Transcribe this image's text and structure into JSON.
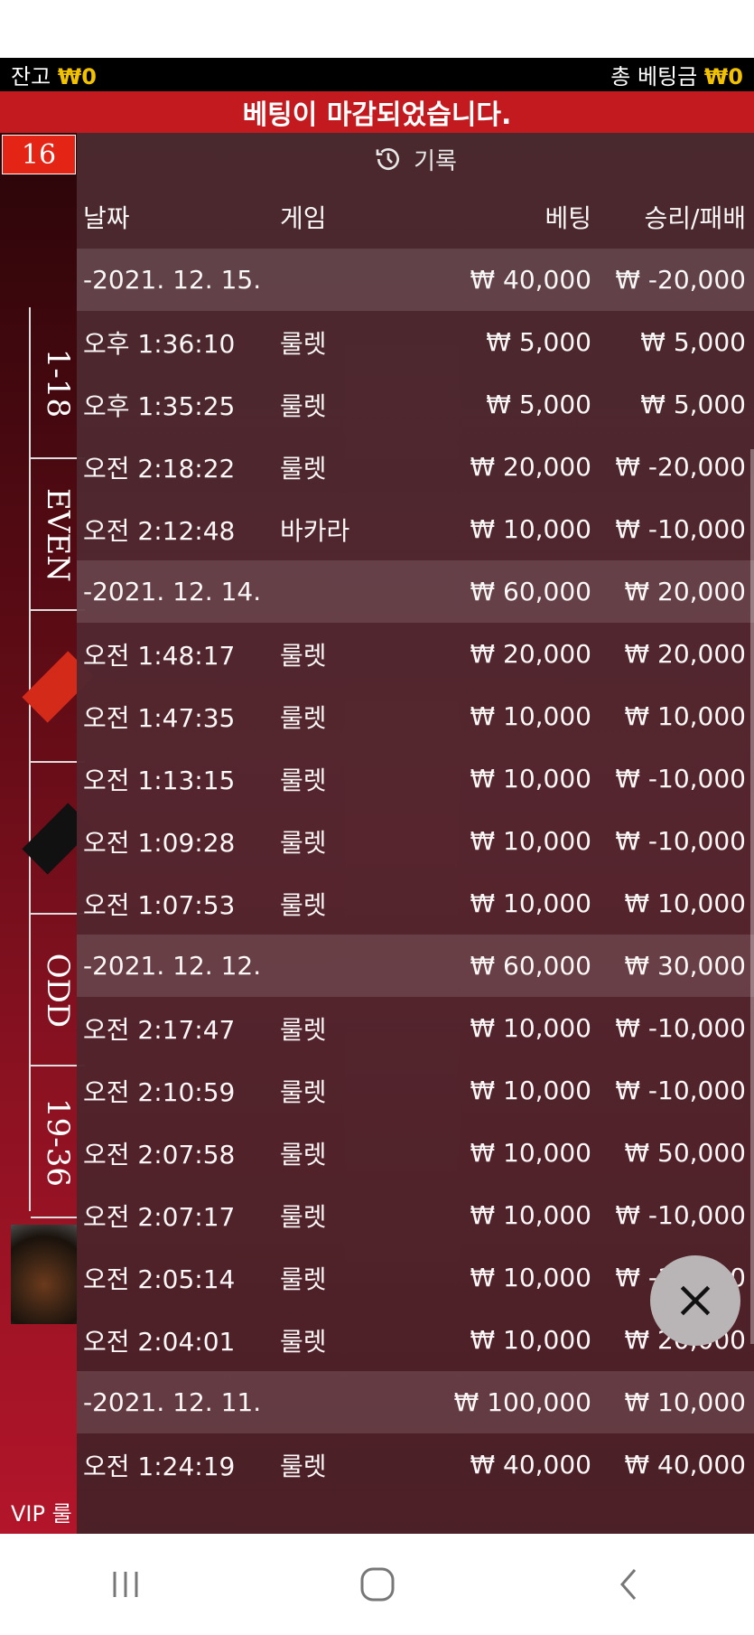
{
  "topbar": {
    "balance_label": "잔고",
    "balance_value": "₩0",
    "total_bet_label": "총 베팅금",
    "total_bet_value": "₩0"
  },
  "banner_text": "베팅이 마감되었습니다.",
  "game_number": "16",
  "board_labels": [
    "1-18",
    "EVEN",
    "",
    "",
    "ODD",
    "19-36"
  ],
  "vip_label": "VIP 룰",
  "history": {
    "title": "기록",
    "columns": {
      "date": "날짜",
      "game": "게임",
      "bet": "베팅",
      "result": "승리/패배"
    },
    "groups": [
      {
        "date": "-2021. 12. 15.",
        "bet": "₩ 40,000",
        "result": "₩ -20,000",
        "rows": [
          {
            "time": "오후 1:36:10",
            "game": "룰렛",
            "bet": "₩ 5,000",
            "result": "₩ 5,000"
          },
          {
            "time": "오후 1:35:25",
            "game": "룰렛",
            "bet": "₩ 5,000",
            "result": "₩ 5,000"
          },
          {
            "time": "오전 2:18:22",
            "game": "룰렛",
            "bet": "₩ 20,000",
            "result": "₩ -20,000"
          },
          {
            "time": "오전 2:12:48",
            "game": "바카라",
            "bet": "₩ 10,000",
            "result": "₩ -10,000"
          }
        ]
      },
      {
        "date": "-2021. 12. 14.",
        "bet": "₩ 60,000",
        "result": "₩ 20,000",
        "rows": [
          {
            "time": "오전 1:48:17",
            "game": "룰렛",
            "bet": "₩ 20,000",
            "result": "₩ 20,000"
          },
          {
            "time": "오전 1:47:35",
            "game": "룰렛",
            "bet": "₩ 10,000",
            "result": "₩ 10,000"
          },
          {
            "time": "오전 1:13:15",
            "game": "룰렛",
            "bet": "₩ 10,000",
            "result": "₩ -10,000"
          },
          {
            "time": "오전 1:09:28",
            "game": "룰렛",
            "bet": "₩ 10,000",
            "result": "₩ -10,000"
          },
          {
            "time": "오전 1:07:53",
            "game": "룰렛",
            "bet": "₩ 10,000",
            "result": "₩ 10,000"
          }
        ]
      },
      {
        "date": "-2021. 12. 12.",
        "bet": "₩ 60,000",
        "result": "₩ 30,000",
        "rows": [
          {
            "time": "오전 2:17:47",
            "game": "룰렛",
            "bet": "₩ 10,000",
            "result": "₩ -10,000"
          },
          {
            "time": "오전 2:10:59",
            "game": "룰렛",
            "bet": "₩ 10,000",
            "result": "₩ -10,000"
          },
          {
            "time": "오전 2:07:58",
            "game": "룰렛",
            "bet": "₩ 10,000",
            "result": "₩ 50,000"
          },
          {
            "time": "오전 2:07:17",
            "game": "룰렛",
            "bet": "₩ 10,000",
            "result": "₩ -10,000"
          },
          {
            "time": "오전 2:05:14",
            "game": "룰렛",
            "bet": "₩ 10,000",
            "result": "₩ -10,000"
          },
          {
            "time": "오전 2:04:01",
            "game": "룰렛",
            "bet": "₩ 10,000",
            "result": "₩ 20,000"
          }
        ]
      },
      {
        "date": "-2021. 12. 11.",
        "bet": "₩ 100,000",
        "result": "₩ 10,000",
        "rows": [
          {
            "time": "오전 1:24:19",
            "game": "룰렛",
            "bet": "₩ 40,000",
            "result": "₩ 40,000"
          }
        ]
      }
    ]
  },
  "icons": {
    "history": "history-clock-icon",
    "close": "close-icon",
    "nav_recent": "recent-apps-icon",
    "nav_home": "home-icon",
    "nav_back": "back-icon"
  },
  "colors": {
    "gold": "#f2c200",
    "banner": "#c21a1f",
    "badge": "#e42515"
  }
}
